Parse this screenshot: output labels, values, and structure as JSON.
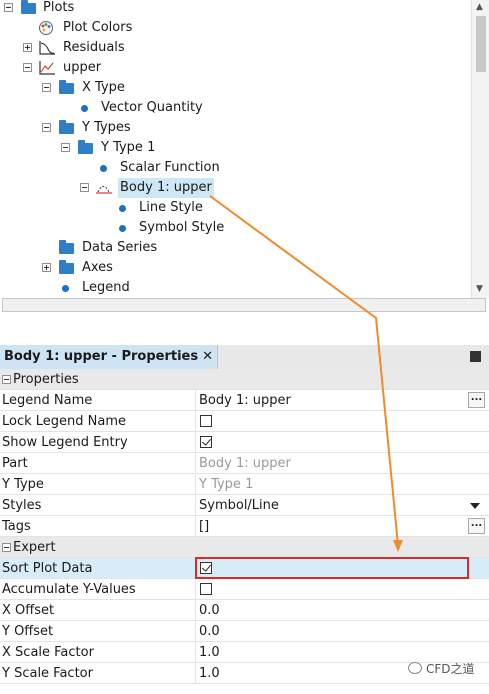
{
  "tree": {
    "items": [
      {
        "label": "Plots"
      },
      {
        "label": "Plot Colors"
      },
      {
        "label": "Residuals"
      },
      {
        "label": "upper"
      },
      {
        "label": "X Type"
      },
      {
        "label": "Vector Quantity"
      },
      {
        "label": "Y Types"
      },
      {
        "label": "Y Type 1"
      },
      {
        "label": "Scalar Function"
      },
      {
        "label": "Body 1: upper"
      },
      {
        "label": "Line Style"
      },
      {
        "label": "Symbol Style"
      },
      {
        "label": "Data Series"
      },
      {
        "label": "Axes"
      },
      {
        "label": "Legend"
      }
    ]
  },
  "properties": {
    "tab_title": "Body 1: upper - Properties",
    "close_glyph": "✕",
    "section_properties": "Properties",
    "section_expert": "Expert",
    "rows": {
      "legend_name": {
        "name": "Legend Name",
        "value": "Body 1: upper"
      },
      "lock_legend_name": {
        "name": "Lock Legend Name",
        "checked": false
      },
      "show_legend_entry": {
        "name": "Show Legend Entry",
        "checked": true
      },
      "part": {
        "name": "Part",
        "value": "Body 1: upper"
      },
      "y_type": {
        "name": "Y Type",
        "value": "Y Type 1"
      },
      "styles": {
        "name": "Styles",
        "value": "Symbol/Line"
      },
      "tags": {
        "name": "Tags",
        "value": "[]"
      },
      "sort_plot_data": {
        "name": "Sort Plot Data",
        "checked": true
      },
      "accumulate_y_values": {
        "name": "Accumulate Y-Values",
        "checked": false
      },
      "x_offset": {
        "name": "X Offset",
        "value": "0.0"
      },
      "y_offset": {
        "name": "Y Offset",
        "value": "0.0"
      },
      "x_scale_factor": {
        "name": "X Scale Factor",
        "value": "1.0"
      },
      "y_scale_factor": {
        "name": "Y Scale Factor",
        "value": "1.0"
      }
    },
    "ellipsis": "..."
  },
  "watermark": "CFD之道",
  "colors": {
    "accent_arrow": "#f08a2c",
    "highlight_box": "#d72a2a",
    "selection": "#cde8f4",
    "folder": "#2f7fc7"
  }
}
